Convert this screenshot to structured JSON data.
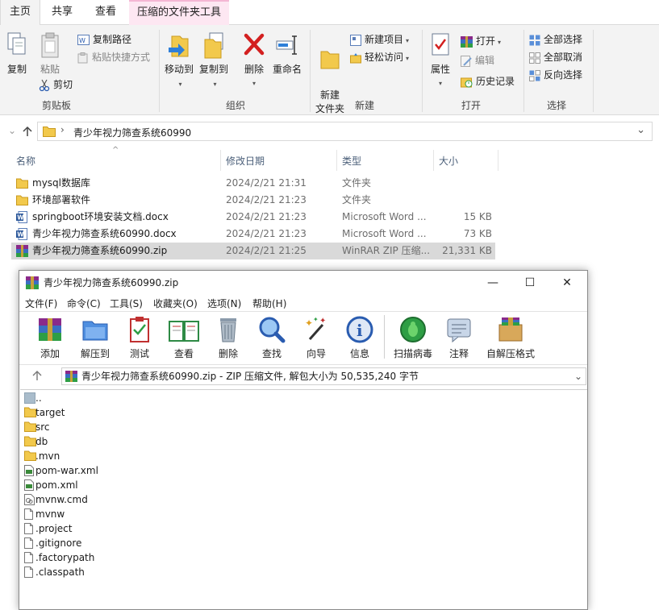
{
  "explorer": {
    "tabs": [
      "主页",
      "共享",
      "查看",
      "压缩的文件夹工具"
    ],
    "ribbon": {
      "clipboard": {
        "copy": "复制",
        "paste": "粘贴",
        "copy_path": "复制路径",
        "paste_shortcut": "粘贴快捷方式",
        "cut": "剪切",
        "label": "剪贴板"
      },
      "organize": {
        "move_to": "移动到",
        "copy_to": "复制到",
        "delete": "删除",
        "rename": "重命名",
        "label": "组织"
      },
      "new": {
        "new_folder": "新建\n文件夹",
        "new_item": "新建项目",
        "easy_access": "轻松访问",
        "label": "新建"
      },
      "open": {
        "properties": "属性",
        "open": "打开",
        "edit": "编辑",
        "history": "历史记录",
        "label": "打开"
      },
      "select": {
        "select_all": "全部选择",
        "select_none": "全部取消",
        "invert": "反向选择",
        "label": "选择"
      }
    },
    "address": {
      "separator": "›",
      "path": "青少年视力筛查系统60990"
    },
    "columns": {
      "name": "名称",
      "date": "修改日期",
      "type": "类型",
      "size": "大小"
    },
    "files": [
      {
        "name": "mysql数据库",
        "date": "2024/2/21 21:31",
        "type": "文件夹",
        "size": "",
        "icon": "folder-icon"
      },
      {
        "name": "环境部署软件",
        "date": "2024/2/21 21:23",
        "type": "文件夹",
        "size": "",
        "icon": "folder-icon"
      },
      {
        "name": "springboot环境安装文档.docx",
        "date": "2024/2/21 21:23",
        "type": "Microsoft Word ...",
        "size": "15 KB",
        "icon": "word-icon"
      },
      {
        "name": "青少年视力筛查系统60990.docx",
        "date": "2024/2/21 21:23",
        "type": "Microsoft Word ...",
        "size": "73 KB",
        "icon": "word-icon"
      },
      {
        "name": "青少年视力筛查系统60990.zip",
        "date": "2024/2/21 21:25",
        "type": "WinRAR ZIP 压缩...",
        "size": "21,331 KB",
        "icon": "winrar-icon"
      }
    ]
  },
  "winrar": {
    "title": "青少年视力筛查系统60990.zip",
    "menu": [
      "文件(F)",
      "命令(C)",
      "工具(S)",
      "收藏夹(O)",
      "选项(N)",
      "帮助(H)"
    ],
    "toolbar": [
      "添加",
      "解压到",
      "测试",
      "查看",
      "删除",
      "查找",
      "向导",
      "信息",
      "扫描病毒",
      "注释",
      "自解压格式"
    ],
    "path": "青少年视力筛查系统60990.zip - ZIP 压缩文件, 解包大小为 50,535,240 字节",
    "items": [
      {
        "name": "..",
        "icon": "parent-folder-icon"
      },
      {
        "name": "target",
        "icon": "folder-icon"
      },
      {
        "name": "src",
        "icon": "folder-icon"
      },
      {
        "name": "db",
        "icon": "folder-icon"
      },
      {
        "name": ".mvn",
        "icon": "folder-icon"
      },
      {
        "name": "pom-war.xml",
        "icon": "xml-file-icon"
      },
      {
        "name": "pom.xml",
        "icon": "xml-file-icon"
      },
      {
        "name": "mvnw.cmd",
        "icon": "cmd-file-icon"
      },
      {
        "name": "mvnw",
        "icon": "file-icon"
      },
      {
        "name": ".project",
        "icon": "file-icon"
      },
      {
        "name": ".gitignore",
        "icon": "file-icon"
      },
      {
        "name": ".factorypath",
        "icon": "file-icon"
      },
      {
        "name": ".classpath",
        "icon": "file-icon"
      }
    ]
  }
}
